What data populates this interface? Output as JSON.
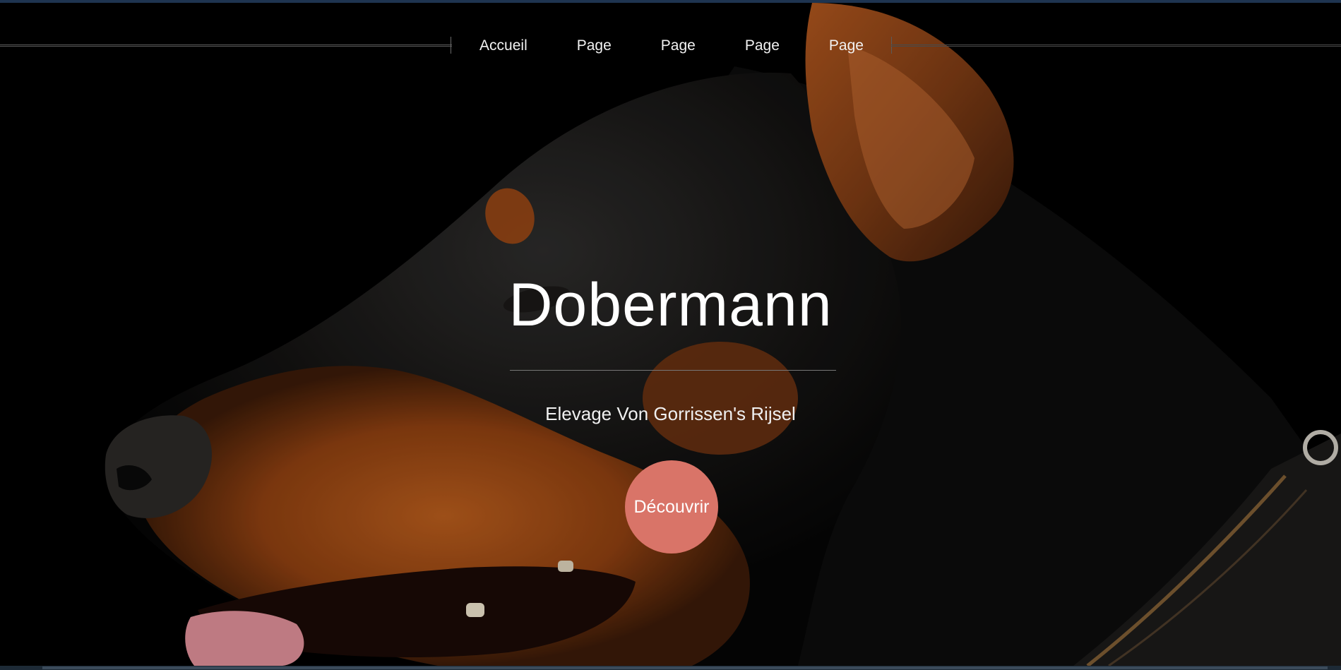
{
  "nav": {
    "items": [
      "Accueil",
      "Page",
      "Page",
      "Page",
      "Page"
    ]
  },
  "hero": {
    "title": "Dobermann",
    "subtitle": "Elevage Von Gorrissen's Rijsel",
    "cta_label": "Découvrir",
    "image": "doberman-profile-photo"
  },
  "colors": {
    "cta": "#d97468",
    "top_bar": "#1e3450",
    "background": "#000000"
  }
}
